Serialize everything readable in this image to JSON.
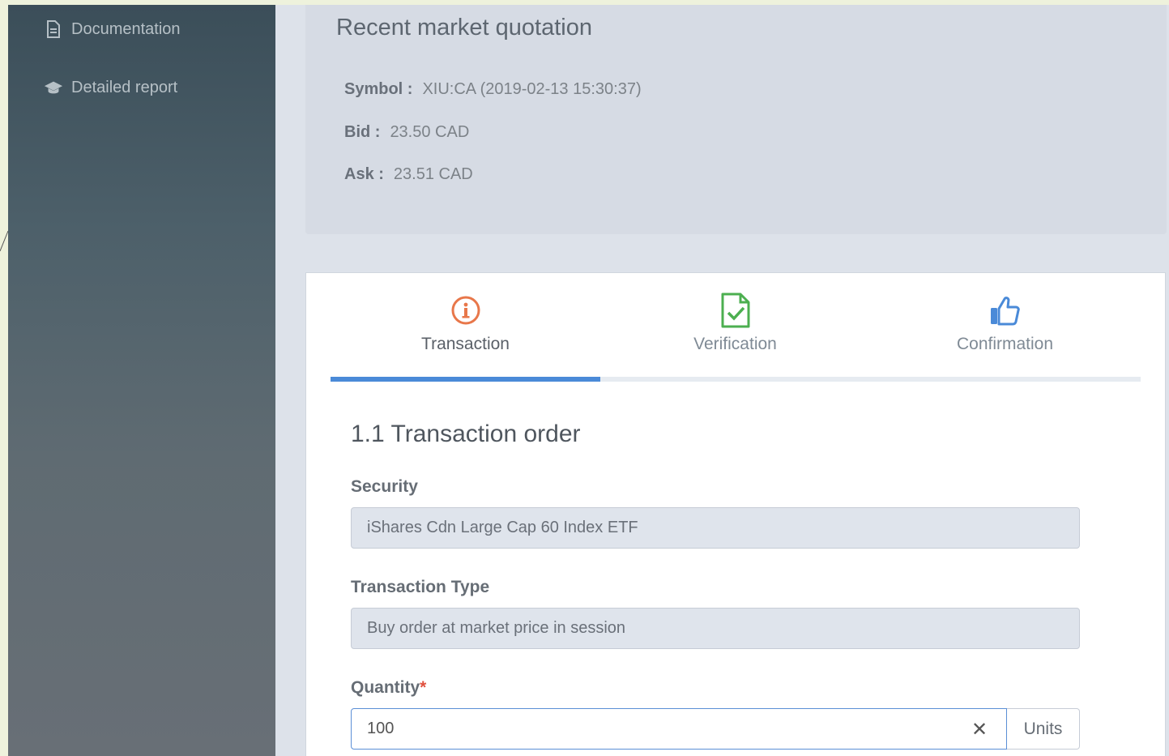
{
  "sidebar": {
    "items": [
      {
        "label": "Documentation",
        "icon": "document-icon"
      },
      {
        "label": "Detailed report",
        "icon": "graduation-cap-icon"
      }
    ]
  },
  "quote": {
    "title": "Recent market quotation",
    "symbol_key": "Symbol :",
    "symbol_value": "XIU:CA (2019-02-13 15:30:37)",
    "bid_key": "Bid :",
    "bid_value": "23.50 CAD",
    "ask_key": "Ask :",
    "ask_value": "23.51 CAD"
  },
  "wizard": {
    "steps": [
      {
        "label": "Transaction",
        "icon": "info-circle-icon",
        "color": "#e8774a"
      },
      {
        "label": "Verification",
        "icon": "checked-file-icon",
        "color": "#4caf50"
      },
      {
        "label": "Confirmation",
        "icon": "thumbs-up-icon",
        "color": "#4a8ad8"
      }
    ],
    "active_step": 1,
    "progress_fraction": 0.3333
  },
  "form": {
    "section_title": "1.1 Transaction order",
    "security_label": "Security",
    "security_value": "iShares Cdn Large Cap  60 Index ETF",
    "type_label": "Transaction Type",
    "type_value": "Buy order at market price in session",
    "quantity_label": "Quantity",
    "quantity_required": "*",
    "quantity_value": "100",
    "clear_symbol": "✕",
    "units_label": "Units"
  },
  "colors": {
    "accent": "#4a8ad8",
    "required": "#e0513f"
  }
}
